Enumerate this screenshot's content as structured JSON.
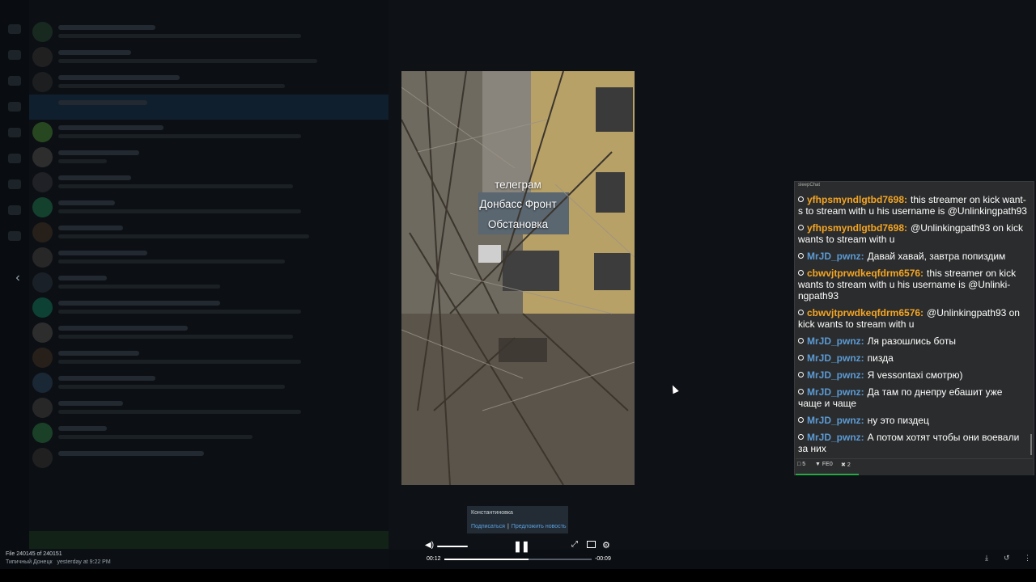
{
  "viewer": {
    "video_overlay": [
      "телеграм",
      "Донбасс Фронт",
      "Обстановка"
    ],
    "caption": {
      "channel": "Константиновка",
      "subscribe": "Подписаться",
      "separator": "|",
      "suggest": "Предложить новость"
    },
    "controls": {
      "current_time": "00:12",
      "remaining_time": "-00:09",
      "progress": 0.57,
      "volume": 1.0
    },
    "file": {
      "counter": "File 240145 of 240151",
      "sender": "Типичный Донецк",
      "date": "yesterday at 9:22 PM"
    }
  },
  "chat_overlay": {
    "title": "sleepChat",
    "messages": [
      {
        "user": "yfhpsmyndlgtbd7698:",
        "text": "this streamer on kick want-s to stream with u his username is @Unlinkingpath93",
        "color": "#f5a623"
      },
      {
        "user": "yfhpsmyndlgtbd7698:",
        "text": "@Unlinkingpath93 on kick wants to stream with u",
        "color": "#f5a623"
      },
      {
        "user": "MrJD_pwnz:",
        "text": "Давай хавай, завтра попиздим",
        "color": "#5b9bd5"
      },
      {
        "user": "cbwvjtprwdkeqfdrm6576:",
        "text": "this streamer on kick wants to stream with u his username is @Unlinki-ngpath93",
        "color": "#f5a623"
      },
      {
        "user": "cbwvjtprwdkeqfdrm6576:",
        "text": "@Unlinkingpath93 on kick wants to stream with u",
        "color": "#f5a623"
      },
      {
        "user": "MrJD_pwnz:",
        "text": "Ля разошлись боты",
        "color": "#5b9bd5"
      },
      {
        "user": "MrJD_pwnz:",
        "text": "пизда",
        "color": "#5b9bd5"
      },
      {
        "user": "MrJD_pwnz:",
        "text": "Я vessontaxi смотрю)",
        "color": "#5b9bd5"
      },
      {
        "user": "MrJD_pwnz:",
        "text": "Да там по днепру ебашит уже чаще и чаще",
        "color": "#5b9bd5"
      },
      {
        "user": "MrJD_pwnz:",
        "text": "ну это пиздец",
        "color": "#5b9bd5"
      },
      {
        "user": "MrJD_pwnz:",
        "text": "А потом хотят чтобы они воевали за них",
        "color": "#5b9bd5"
      }
    ],
    "footer": {
      "count1": "5",
      "count2": "FE0",
      "count3": "2"
    }
  }
}
